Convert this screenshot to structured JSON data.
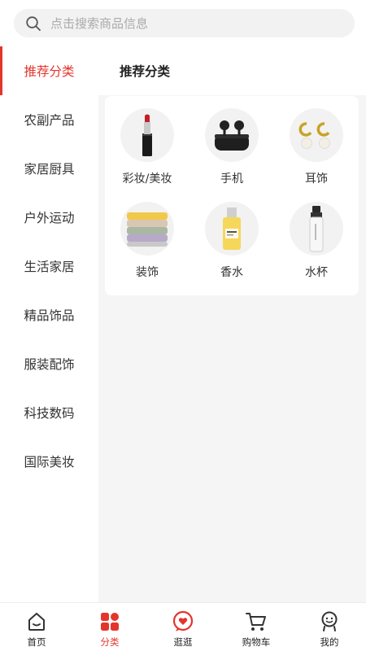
{
  "search": {
    "placeholder": "点击搜索商品信息",
    "icon": "search-icon"
  },
  "sidebar": {
    "active_index": 0,
    "items": [
      {
        "label": "推荐分类"
      },
      {
        "label": "农副产品"
      },
      {
        "label": "家居厨具"
      },
      {
        "label": "户外运动"
      },
      {
        "label": "生活家居"
      },
      {
        "label": "精品饰品"
      },
      {
        "label": "服装配饰"
      },
      {
        "label": "科技数码"
      },
      {
        "label": "国际美妆"
      }
    ]
  },
  "main": {
    "title": "推荐分类",
    "categories": [
      {
        "label": "彩妆/美妆",
        "icon": "lipstick-icon"
      },
      {
        "label": "手机",
        "icon": "earbuds-icon"
      },
      {
        "label": "耳饰",
        "icon": "earrings-icon"
      },
      {
        "label": "装饰",
        "icon": "towel-stack-icon"
      },
      {
        "label": "香水",
        "icon": "perfume-bottle-icon"
      },
      {
        "label": "水杯",
        "icon": "water-bottle-icon"
      }
    ]
  },
  "tabbar": {
    "active_index": 1,
    "items": [
      {
        "label": "首页",
        "icon": "home-icon"
      },
      {
        "label": "分类",
        "icon": "category-grid-icon"
      },
      {
        "label": "逛逛",
        "icon": "heart-chat-icon"
      },
      {
        "label": "购物车",
        "icon": "cart-icon"
      },
      {
        "label": "我的",
        "icon": "profile-icon"
      }
    ]
  },
  "colors": {
    "accent": "#e3352b",
    "background": "#f5f5f5",
    "text": "#333333"
  }
}
